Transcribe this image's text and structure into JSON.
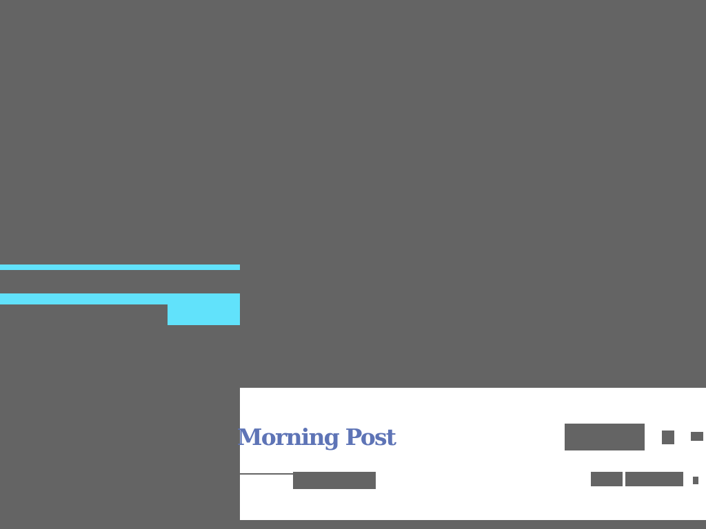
{
  "masthead": {
    "title": "Morning Post",
    "title_color": "#5e74b6"
  },
  "colors": {
    "backdrop": "#646464",
    "accent": "#61e2fb",
    "panel": "#ffffff",
    "placeholder": "#646464"
  }
}
